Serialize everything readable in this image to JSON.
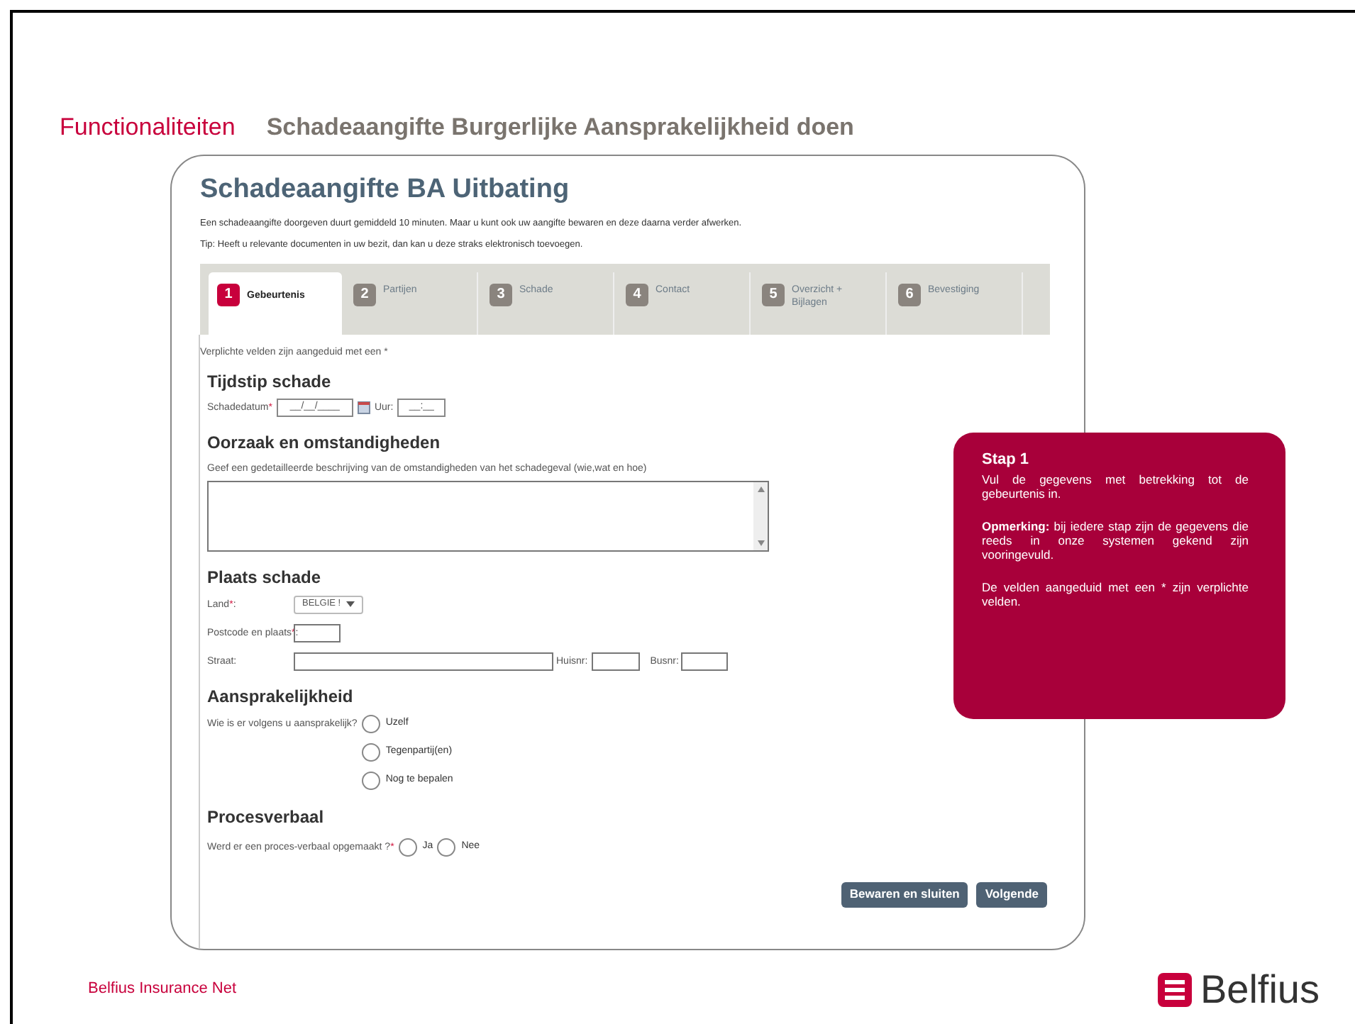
{
  "slide": {
    "section": "Functionaliteiten",
    "title": "Schadeaangifte Burgerlijke Aansprakelijkheid doen"
  },
  "form": {
    "title": "Schadeaangifte BA Uitbating",
    "intro": [
      "Een schadeaangifte doorgeven duurt gemiddeld 10 minuten. Maar u kunt ook uw aangifte bewaren en deze daarna verder afwerken.",
      "Tip: Heeft u relevante documenten in uw bezit, dan kan u deze straks elektronisch toevoegen."
    ],
    "tabs": [
      {
        "number": "1",
        "label": "Gebeurtenis",
        "selected": true
      },
      {
        "number": "2",
        "label": "Partijen",
        "selected": false
      },
      {
        "number": "3",
        "label": "Schade",
        "selected": false
      },
      {
        "number": "4",
        "label": "Contact",
        "selected": false
      },
      {
        "number": "5",
        "label": "Overzicht + Bijlagen",
        "selected": false
      },
      {
        "number": "6",
        "label": "Bevestiging",
        "selected": false
      }
    ],
    "required_note": "Verplichte velden zijn aangeduid met een *",
    "required_mark": "*",
    "time": {
      "heading": "Tijdstip schade",
      "date_label": "Schadedatum",
      "date_required": true,
      "date_value": "__/__/____",
      "time_label": "Uur:",
      "time_value": "__:__"
    },
    "cause": {
      "heading": "Oorzaak en omstandigheden",
      "prompt": "Geef een gedetailleerde beschrijving van de omstandigheden van het schadegeval (wie,wat en hoe)"
    },
    "place": {
      "heading": "Plaats schade",
      "country": {
        "label": "Land",
        "required": true,
        "suffix": ":",
        "value": "BELGIE !"
      },
      "postcode": {
        "label": "Postcode en plaats",
        "required": true,
        "suffix": ":"
      },
      "street": {
        "label": "Straat:"
      },
      "house_label": "Huisnr:",
      "box_label": "Busnr:"
    },
    "liability": {
      "heading": "Aansprakelijkheid",
      "question": "Wie is er volgens u aansprakelijk?",
      "options": [
        {
          "label": "Uzelf",
          "selected": false
        },
        {
          "label": "Tegenpartij(en)",
          "selected": false
        },
        {
          "label": "Nog te bepalen",
          "selected": false
        }
      ]
    },
    "report": {
      "heading": "Procesverbaal",
      "question": "Werd er een proces-verbaal opgemaakt ?",
      "required": true,
      "options": [
        {
          "label": "Ja",
          "selected": false
        },
        {
          "label": "Nee",
          "selected": false
        }
      ]
    },
    "buttons": [
      "Bewaren en sluiten",
      "Volgende"
    ]
  },
  "callout": {
    "title": "Stap 1",
    "paragraphs": [
      "Vul de gegevens met betrekking tot de gebeurtenis in.",
      "**Opmerking:** bij iedere stap zijn de gegevens die reeds in onze systemen gekend zijn vooringevuld.",
      "De velden aangeduid met een * zijn verplichte velden."
    ]
  },
  "footer": {
    "text": "Belfius Insurance Net",
    "logo": "Belfius"
  }
}
